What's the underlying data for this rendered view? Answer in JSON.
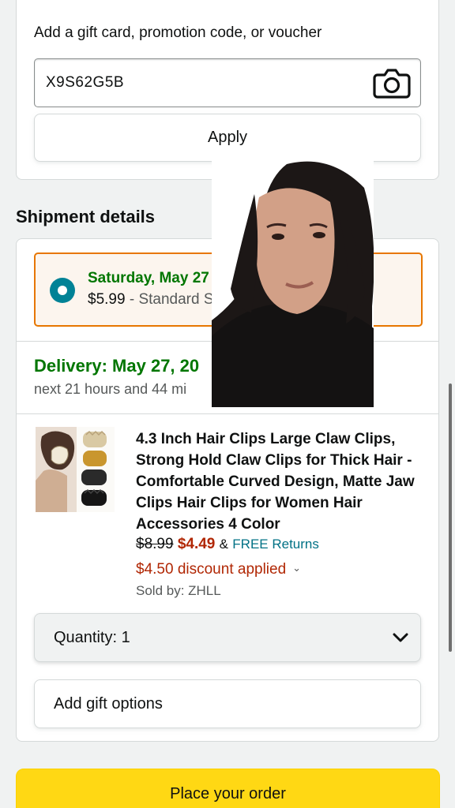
{
  "promo": {
    "label": "Add a gift card, promotion code, or voucher",
    "code_value": "X9S62G5B",
    "apply_label": "Apply"
  },
  "shipment": {
    "section_title": "Shipment details",
    "option": {
      "date": "Saturday, May 27",
      "price": "$5.99",
      "separator": " - ",
      "method": "Standard Ship"
    },
    "delivery_headline": "Delivery: May 27, 20",
    "countdown": "next 21 hours and 44 mi"
  },
  "product": {
    "title": "4.3 Inch Hair Clips Large Claw Clips, Strong Hold Claw Clips for Thick Hair - Comfortable Curved Design, Matte Jaw Clips Hair Clips for Women Hair Accessories 4 Color",
    "old_price": "$8.99",
    "new_price": "$4.49",
    "returns_prefix": "&",
    "returns": "FREE Returns",
    "discount": "$4.50 discount applied",
    "sold_by": "Sold by: ZHLL"
  },
  "quantity": {
    "label": "Quantity:",
    "value": "1"
  },
  "gift": {
    "label": "Add gift options"
  },
  "place_order_label": "Place your order",
  "colors": {
    "accent_orange": "#e77600",
    "delivery_green": "#007600",
    "price_red": "#b12704",
    "link_teal": "#007185",
    "radio_teal": "#008296",
    "button_yellow": "#ffd814"
  },
  "icons": [
    "camera-icon",
    "radio-selected-icon",
    "chevron-down-icon",
    "chevron-down-small-icon"
  ]
}
